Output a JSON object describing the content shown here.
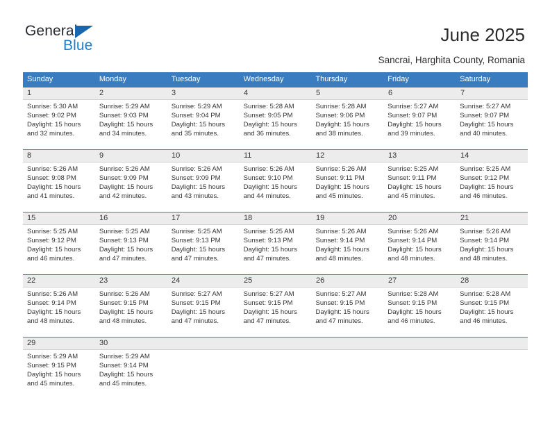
{
  "brand": {
    "name_top": "General",
    "name_bottom": "Blue",
    "triangle_color": "#1666b0",
    "blue_color": "#1a7fd4"
  },
  "header": {
    "title": "June 2025",
    "subtitle": "Sancrai, Harghita County, Romania"
  },
  "theme": {
    "header_blue": "#3a7cc0",
    "daynum_bg": "#ececec",
    "text": "#333333"
  },
  "weekdays": [
    "Sunday",
    "Monday",
    "Tuesday",
    "Wednesday",
    "Thursday",
    "Friday",
    "Saturday"
  ],
  "weeks": [
    {
      "days": [
        {
          "num": "1",
          "l1": "Sunrise: 5:30 AM",
          "l2": "Sunset: 9:02 PM",
          "l3": "Daylight: 15 hours",
          "l4": "and 32 minutes."
        },
        {
          "num": "2",
          "l1": "Sunrise: 5:29 AM",
          "l2": "Sunset: 9:03 PM",
          "l3": "Daylight: 15 hours",
          "l4": "and 34 minutes."
        },
        {
          "num": "3",
          "l1": "Sunrise: 5:29 AM",
          "l2": "Sunset: 9:04 PM",
          "l3": "Daylight: 15 hours",
          "l4": "and 35 minutes."
        },
        {
          "num": "4",
          "l1": "Sunrise: 5:28 AM",
          "l2": "Sunset: 9:05 PM",
          "l3": "Daylight: 15 hours",
          "l4": "and 36 minutes."
        },
        {
          "num": "5",
          "l1": "Sunrise: 5:28 AM",
          "l2": "Sunset: 9:06 PM",
          "l3": "Daylight: 15 hours",
          "l4": "and 38 minutes."
        },
        {
          "num": "6",
          "l1": "Sunrise: 5:27 AM",
          "l2": "Sunset: 9:07 PM",
          "l3": "Daylight: 15 hours",
          "l4": "and 39 minutes."
        },
        {
          "num": "7",
          "l1": "Sunrise: 5:27 AM",
          "l2": "Sunset: 9:07 PM",
          "l3": "Daylight: 15 hours",
          "l4": "and 40 minutes."
        }
      ]
    },
    {
      "days": [
        {
          "num": "8",
          "l1": "Sunrise: 5:26 AM",
          "l2": "Sunset: 9:08 PM",
          "l3": "Daylight: 15 hours",
          "l4": "and 41 minutes."
        },
        {
          "num": "9",
          "l1": "Sunrise: 5:26 AM",
          "l2": "Sunset: 9:09 PM",
          "l3": "Daylight: 15 hours",
          "l4": "and 42 minutes."
        },
        {
          "num": "10",
          "l1": "Sunrise: 5:26 AM",
          "l2": "Sunset: 9:09 PM",
          "l3": "Daylight: 15 hours",
          "l4": "and 43 minutes."
        },
        {
          "num": "11",
          "l1": "Sunrise: 5:26 AM",
          "l2": "Sunset: 9:10 PM",
          "l3": "Daylight: 15 hours",
          "l4": "and 44 minutes."
        },
        {
          "num": "12",
          "l1": "Sunrise: 5:26 AM",
          "l2": "Sunset: 9:11 PM",
          "l3": "Daylight: 15 hours",
          "l4": "and 45 minutes."
        },
        {
          "num": "13",
          "l1": "Sunrise: 5:25 AM",
          "l2": "Sunset: 9:11 PM",
          "l3": "Daylight: 15 hours",
          "l4": "and 45 minutes."
        },
        {
          "num": "14",
          "l1": "Sunrise: 5:25 AM",
          "l2": "Sunset: 9:12 PM",
          "l3": "Daylight: 15 hours",
          "l4": "and 46 minutes."
        }
      ]
    },
    {
      "days": [
        {
          "num": "15",
          "l1": "Sunrise: 5:25 AM",
          "l2": "Sunset: 9:12 PM",
          "l3": "Daylight: 15 hours",
          "l4": "and 46 minutes."
        },
        {
          "num": "16",
          "l1": "Sunrise: 5:25 AM",
          "l2": "Sunset: 9:13 PM",
          "l3": "Daylight: 15 hours",
          "l4": "and 47 minutes."
        },
        {
          "num": "17",
          "l1": "Sunrise: 5:25 AM",
          "l2": "Sunset: 9:13 PM",
          "l3": "Daylight: 15 hours",
          "l4": "and 47 minutes."
        },
        {
          "num": "18",
          "l1": "Sunrise: 5:25 AM",
          "l2": "Sunset: 9:13 PM",
          "l3": "Daylight: 15 hours",
          "l4": "and 47 minutes."
        },
        {
          "num": "19",
          "l1": "Sunrise: 5:26 AM",
          "l2": "Sunset: 9:14 PM",
          "l3": "Daylight: 15 hours",
          "l4": "and 48 minutes."
        },
        {
          "num": "20",
          "l1": "Sunrise: 5:26 AM",
          "l2": "Sunset: 9:14 PM",
          "l3": "Daylight: 15 hours",
          "l4": "and 48 minutes."
        },
        {
          "num": "21",
          "l1": "Sunrise: 5:26 AM",
          "l2": "Sunset: 9:14 PM",
          "l3": "Daylight: 15 hours",
          "l4": "and 48 minutes."
        }
      ]
    },
    {
      "days": [
        {
          "num": "22",
          "l1": "Sunrise: 5:26 AM",
          "l2": "Sunset: 9:14 PM",
          "l3": "Daylight: 15 hours",
          "l4": "and 48 minutes."
        },
        {
          "num": "23",
          "l1": "Sunrise: 5:26 AM",
          "l2": "Sunset: 9:15 PM",
          "l3": "Daylight: 15 hours",
          "l4": "and 48 minutes."
        },
        {
          "num": "24",
          "l1": "Sunrise: 5:27 AM",
          "l2": "Sunset: 9:15 PM",
          "l3": "Daylight: 15 hours",
          "l4": "and 47 minutes."
        },
        {
          "num": "25",
          "l1": "Sunrise: 5:27 AM",
          "l2": "Sunset: 9:15 PM",
          "l3": "Daylight: 15 hours",
          "l4": "and 47 minutes."
        },
        {
          "num": "26",
          "l1": "Sunrise: 5:27 AM",
          "l2": "Sunset: 9:15 PM",
          "l3": "Daylight: 15 hours",
          "l4": "and 47 minutes."
        },
        {
          "num": "27",
          "l1": "Sunrise: 5:28 AM",
          "l2": "Sunset: 9:15 PM",
          "l3": "Daylight: 15 hours",
          "l4": "and 46 minutes."
        },
        {
          "num": "28",
          "l1": "Sunrise: 5:28 AM",
          "l2": "Sunset: 9:15 PM",
          "l3": "Daylight: 15 hours",
          "l4": "and 46 minutes."
        }
      ]
    },
    {
      "days": [
        {
          "num": "29",
          "l1": "Sunrise: 5:29 AM",
          "l2": "Sunset: 9:15 PM",
          "l3": "Daylight: 15 hours",
          "l4": "and 45 minutes."
        },
        {
          "num": "30",
          "l1": "Sunrise: 5:29 AM",
          "l2": "Sunset: 9:14 PM",
          "l3": "Daylight: 15 hours",
          "l4": "and 45 minutes."
        },
        {
          "num": "",
          "l1": "",
          "l2": "",
          "l3": "",
          "l4": ""
        },
        {
          "num": "",
          "l1": "",
          "l2": "",
          "l3": "",
          "l4": ""
        },
        {
          "num": "",
          "l1": "",
          "l2": "",
          "l3": "",
          "l4": ""
        },
        {
          "num": "",
          "l1": "",
          "l2": "",
          "l3": "",
          "l4": ""
        },
        {
          "num": "",
          "l1": "",
          "l2": "",
          "l3": "",
          "l4": ""
        }
      ]
    }
  ]
}
